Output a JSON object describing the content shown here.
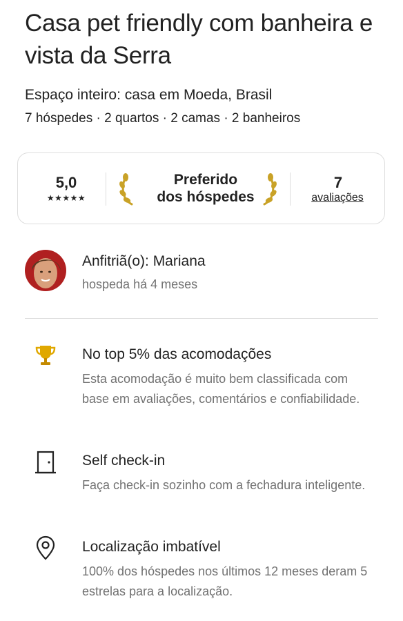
{
  "listing": {
    "title": "Casa pet  friendly com banheira e vista da Serra",
    "subtitle": "Espaço inteiro: casa em Moeda, Brasil",
    "details": "7 hóspedes · 2 quartos · 2 camas · 2 banheiros"
  },
  "rating": {
    "score": "5,0",
    "stars": "★★★★★",
    "badge_line1": "Preferido",
    "badge_line2": "dos hóspedes",
    "reviews_count": "7",
    "reviews_label": "avaliações"
  },
  "host": {
    "name": "Anfitriã(o): Mariana",
    "since": "hospeda há 4 meses"
  },
  "features": [
    {
      "icon": "trophy-icon",
      "title": "No top 5% das acomodações",
      "description": "Esta acomodação é muito bem classificada com base em avaliações, comentários e confiabilidade."
    },
    {
      "icon": "door-icon",
      "title": "Self check-in",
      "description": "Faça check-in sozinho com a fechadura inteligente."
    },
    {
      "icon": "location-pin-icon",
      "title": "Localização imbatível",
      "description": "100% dos hóspedes nos últimos 12 meses deram 5 estrelas para a localização."
    }
  ],
  "colors": {
    "text": "#222222",
    "muted": "#717171",
    "border": "#dddddd",
    "laurel_gold": "#c9a227",
    "trophy_gold": "#e0a800"
  }
}
